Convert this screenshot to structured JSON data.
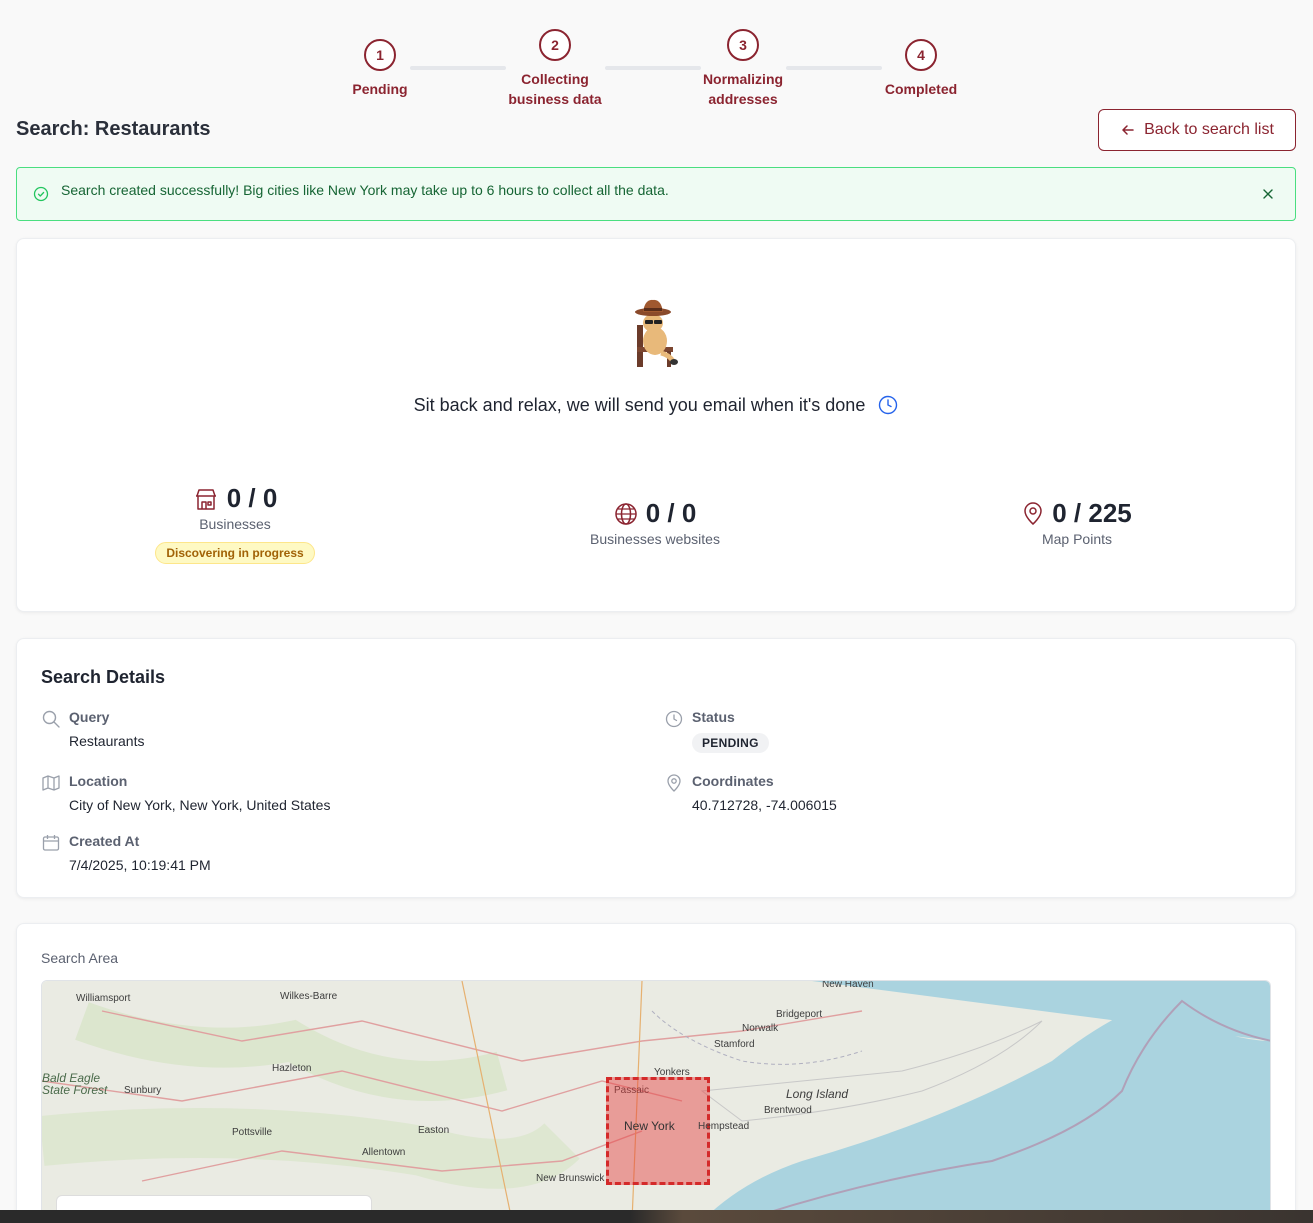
{
  "stepper": {
    "steps": [
      {
        "number": "1",
        "label_line1": "Pending",
        "label_line2": ""
      },
      {
        "number": "2",
        "label_line1": "Collecting",
        "label_line2": "business data"
      },
      {
        "number": "3",
        "label_line1": "Normalizing",
        "label_line2": "addresses"
      },
      {
        "number": "4",
        "label_line1": "Completed",
        "label_line2": ""
      }
    ]
  },
  "header": {
    "title": "Search: Restaurants",
    "back_label": "Back to search list"
  },
  "alert": {
    "message": "Search created successfully! Big cities like New York may take up to 6 hours to collect all the data."
  },
  "progress": {
    "message": "Sit back and relax, we will send you email when it's done",
    "stats": [
      {
        "value": "0 / 0",
        "label": "Businesses",
        "badge": "Discovering in progress"
      },
      {
        "value": "0 / 0",
        "label": "Businesses websites"
      },
      {
        "value": "0 / 225",
        "label": "Map Points"
      }
    ]
  },
  "details": {
    "title": "Search Details",
    "query_label": "Query",
    "query_value": "Restaurants",
    "location_label": "Location",
    "location_value": "City of New York, New York, United States",
    "created_label": "Created At",
    "created_value": "7/4/2025, 10:19:41 PM",
    "status_label": "Status",
    "status_value": "PENDING",
    "coords_label": "Coordinates",
    "coords_value": "40.712728, -74.006015"
  },
  "search_area": {
    "title": "Search Area",
    "map_labels": [
      "New Haven",
      "Williamsport",
      "Wilkes-Barre",
      "Bridgeport",
      "Norwalk",
      "Stamford",
      "Hazleton",
      "Yonkers",
      "Bald Eagle",
      "State Forest",
      "Sunbury",
      "Passaic",
      "Long Island",
      "Brentwood",
      "Pottsville",
      "Easton",
      "New York",
      "Hempstead",
      "Allentown",
      "New Brunswick"
    ]
  },
  "colors": {
    "brand": "#8b2430",
    "success_bg": "#effbf3",
    "success_border": "#4ade80",
    "selection": "#d42a2a",
    "water": "#aad3df"
  }
}
